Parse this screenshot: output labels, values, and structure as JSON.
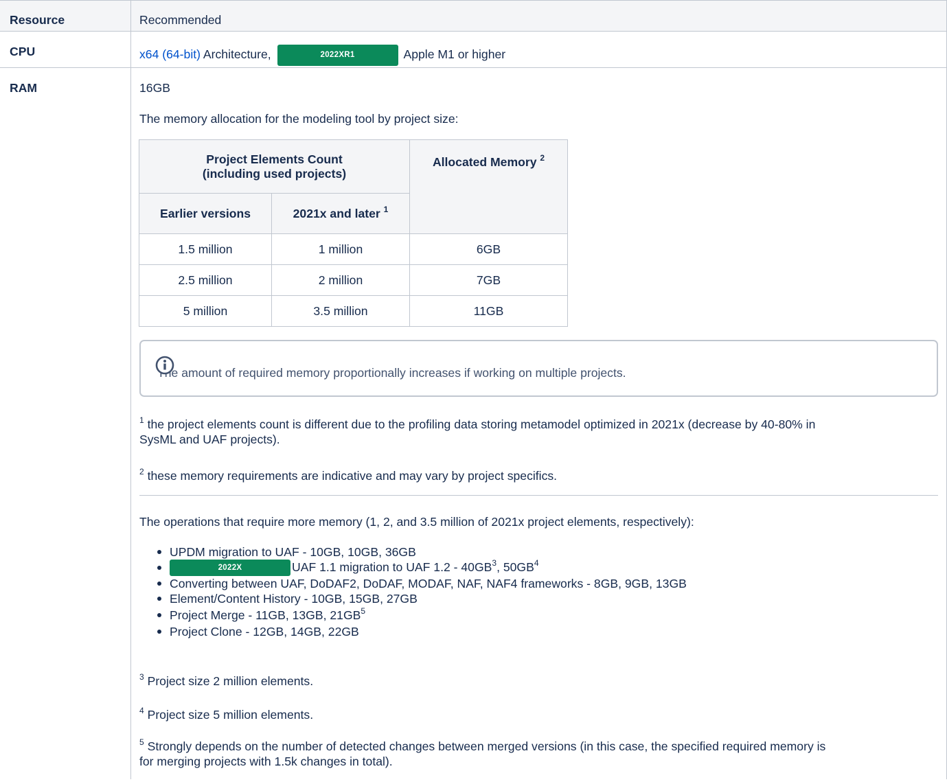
{
  "header": {
    "col1": "Resource",
    "col2": "Recommended"
  },
  "cpu": {
    "label": "CPU",
    "arch_link": "x64 (64-bit)",
    "arch_text": "Architecture,",
    "badge": "2022XR1",
    "apple": "Apple M1 or higher"
  },
  "ram": {
    "label": "RAM",
    "size": "16GB",
    "intro": "The memory allocation for the modeling tool by project size:",
    "table": {
      "group_header_line1": "Project Elements Count",
      "group_header_line2": "(including used projects)",
      "alloc_header": "Allocated Memory",
      "alloc_sup": "2",
      "col_earlier": "Earlier versions",
      "col_later": "2021x and later",
      "col_later_sup": "1",
      "rows": [
        {
          "earlier": "1.5 million",
          "later": "1 million",
          "memory": "6GB"
        },
        {
          "earlier": "2.5 million",
          "later": "2 million",
          "memory": "7GB"
        },
        {
          "earlier": "5 million",
          "later": "3.5 million",
          "memory": "11GB"
        }
      ]
    },
    "info_text": "The amount of required memory proportionally increases if working on multiple projects.",
    "fn1_sup": "1",
    "fn1_line1": "the project elements count is different due to the profiling data storing metamodel optimized in 2021x (decrease by 40-80% in",
    "fn1_line2": "SysML and UAF projects).",
    "fn2_sup": "2",
    "fn2": "these memory requirements are indicative and may vary by project specifics.",
    "ops_intro": "The operations that require more memory (1, 2, and 3.5 million of 2021x project elements, respectively):",
    "ops": {
      "item1": "UPDM migration to UAF - 10GB, 10GB, 36GB",
      "item2_badge": "2022X",
      "item2_text": "UAF 1.1 migration to UAF 1.2 - 40GB",
      "item2_sup3": "3",
      "item2_mid": ", 50GB",
      "item2_sup4": "4",
      "item3": "Converting between UAF, DoDAF2, DoDAF, MODAF, NAF, NAF4 frameworks - 8GB, 9GB, 13GB",
      "item4": "Element/Content History - 10GB, 15GB, 27GB",
      "item5_text": "Project Merge - 11GB, 13GB, 21GB",
      "item5_sup": "5",
      "item6": "Project Clone - 12GB, 14GB, 22GB"
    },
    "fn3_sup": "3",
    "fn3": "Project size 2 million elements.",
    "fn4_sup": "4",
    "fn4": "Project size 5 million elements.",
    "fn5_sup": "5",
    "fn5_line1": "Strongly depends on the number of detected changes between merged versions (in this case, the specified required memory is",
    "fn5_line2": "for merging projects with 1.5k changes in total)."
  }
}
